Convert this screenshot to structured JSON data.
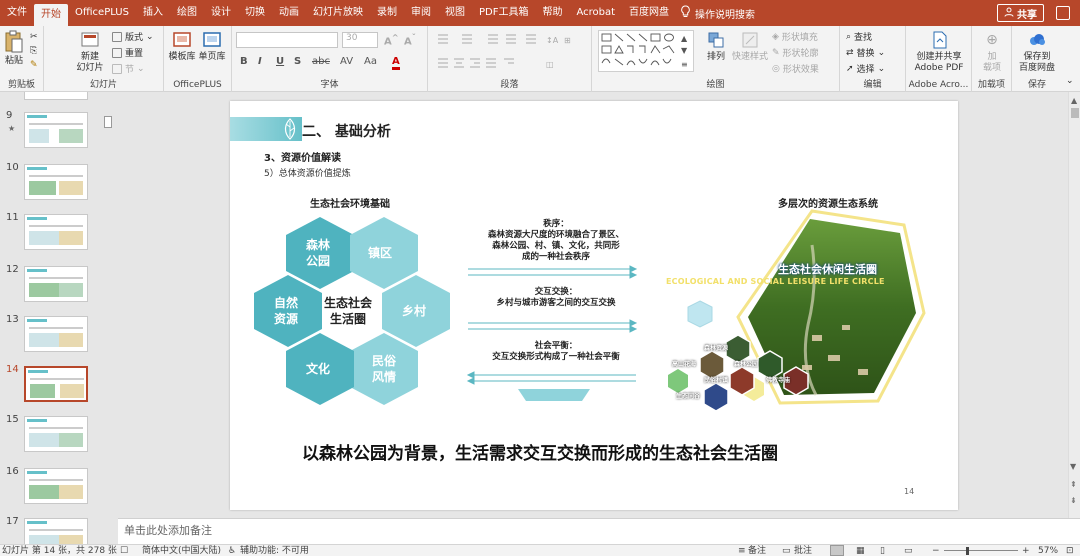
{
  "tabs": [
    "文件",
    "开始",
    "OfficePLUS",
    "插入",
    "绘图",
    "设计",
    "切换",
    "动画",
    "幻灯片放映",
    "录制",
    "审阅",
    "视图",
    "PDF工具箱",
    "帮助",
    "Acrobat",
    "百度网盘"
  ],
  "active_tab": "开始",
  "tell_me": "操作说明搜索",
  "share": "共享",
  "ribbon": {
    "clipboard": {
      "paste": "粘贴",
      "label": "剪贴板"
    },
    "slides": {
      "new_slide": "新建\n幻灯片",
      "layout": "版式",
      "reset": "重置",
      "section": "节",
      "label": "幻灯片"
    },
    "officeplus": {
      "template": "模板库",
      "single": "单页库",
      "label": "OfficePLUS"
    },
    "font": {
      "label": "字体",
      "size": "30",
      "bold": "B",
      "italic": "I",
      "underline": "U",
      "strike": "S",
      "abc": "abc",
      "av": "AV",
      "aa": "Aa",
      "fontcolor": "A"
    },
    "paragraph": {
      "label": "段落"
    },
    "drawing": {
      "arrange": "排列",
      "quick_styles": "快速样式",
      "fill": "形状填充",
      "outline": "形状轮廓",
      "effects": "形状效果",
      "label": "绘图"
    },
    "editing": {
      "find": "查找",
      "replace": "替换",
      "select": "选择",
      "label": "编辑"
    },
    "adobe": {
      "create": "创建并共享\nAdobe PDF",
      "label": "Adobe Acro..."
    },
    "addins": {
      "add": "加\n载项",
      "label": "加载项"
    },
    "save": {
      "save_to": "保存到\n百度网盘",
      "label": "保存"
    }
  },
  "thumbnails": [
    {
      "num": "9",
      "star": true
    },
    {
      "num": "10",
      "star": false
    },
    {
      "num": "11",
      "star": false
    },
    {
      "num": "12",
      "star": false
    },
    {
      "num": "13",
      "star": false
    },
    {
      "num": "14",
      "star": false,
      "selected": true
    },
    {
      "num": "15",
      "star": false
    },
    {
      "num": "16",
      "star": false
    },
    {
      "num": "17",
      "star": false
    }
  ],
  "slide": {
    "section_title": "二、 基础分析",
    "subtitle": "3、资源价值解读",
    "subsubtitle": "5）总体资源价值提炼",
    "left_heading": "生态社会环境基础",
    "right_heading": "多层次的资源生态系统",
    "hex_center": "生态社会\n生活圈",
    "hex_labels": [
      "森林\n公园",
      "镇区",
      "乡村",
      "民俗\n风情",
      "文化",
      "自然\n资源"
    ],
    "mid_blocks": [
      {
        "title": "秩序：",
        "lines": [
          "森林资源大尺度的环境融合了景区、",
          "森林公园、村、镇、文化，共同形",
          "成的一种社会秩序"
        ]
      },
      {
        "title": "交互交换：",
        "lines": [
          "乡村与城市游客之间的交互交换"
        ]
      },
      {
        "title": "社会平衡：",
        "lines": [
          "交互交换形式构成了一种社会平衡"
        ]
      }
    ],
    "eco_title": "生态社会休闲生活圈",
    "eco_sub": "ECOLOGICAL AND SOCIAL LEISURE LIFE CIRCLE",
    "small_hex": [
      "高山花海",
      "森林资源",
      "森林公园",
      "民俗村镇",
      "佛教寺庙",
      "生态同谷"
    ],
    "bottom": "以森林公园为背景，生活需求交互交换而形成的生态社会生活圈",
    "page_no": "14"
  },
  "notes_placeholder": "单击此处添加备注",
  "status": {
    "slide_info": "幻灯片 第 14 张，共 278 张",
    "language": "简体中文(中国大陆)",
    "accessibility": "辅助功能: 不可用",
    "notes": "备注",
    "comments": "批注",
    "zoom": "57%"
  },
  "colors": {
    "accent": "#b7472a",
    "teal": "#5bb7c2",
    "teal_light": "#8fd3db",
    "teal_dark": "#3e9aa6",
    "yellow": "#f4e48a"
  }
}
